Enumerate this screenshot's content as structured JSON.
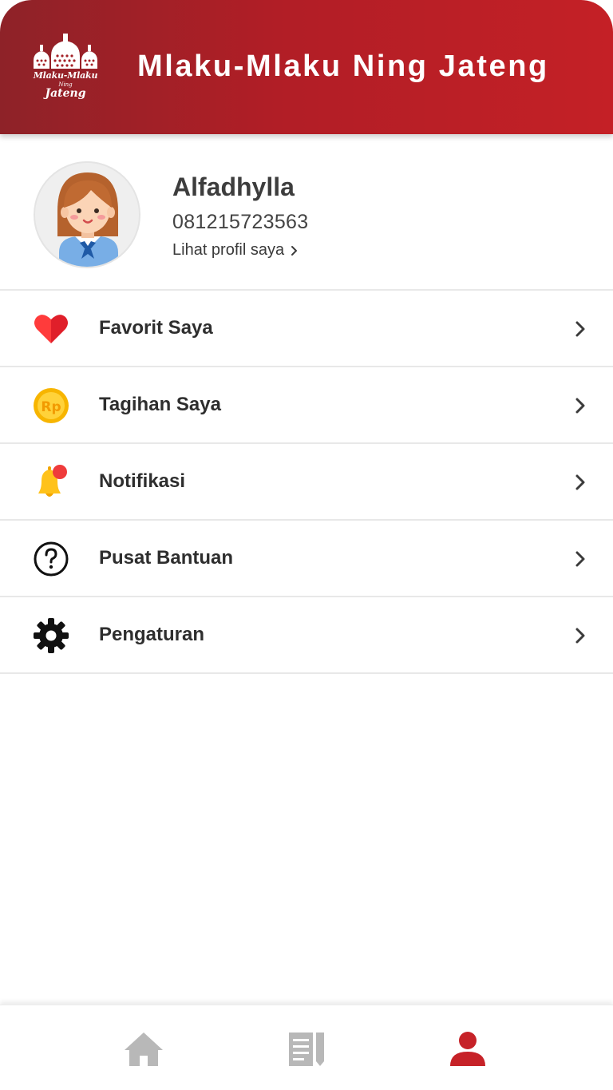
{
  "header": {
    "title": "Mlaku-Mlaku Ning Jateng",
    "logo": {
      "line1": "Mlaku-Mlaku",
      "line2": "Ning",
      "line3": "Jateng"
    }
  },
  "profile": {
    "name": "Alfadhylla",
    "phone": "081215723563",
    "link_label": "Lihat profil saya"
  },
  "menu": {
    "items": [
      {
        "label": "Favorit Saya",
        "icon": "heart-icon"
      },
      {
        "label": "Tagihan Saya",
        "icon": "rupiah-coin-icon"
      },
      {
        "label": "Notifikasi",
        "icon": "bell-icon"
      },
      {
        "label": "Pusat Bantuan",
        "icon": "help-circle-icon"
      },
      {
        "label": "Pengaturan",
        "icon": "gear-icon"
      }
    ]
  },
  "bottom_nav": {
    "items": [
      {
        "name": "home",
        "icon": "home-icon",
        "active": false
      },
      {
        "name": "articles",
        "icon": "news-icon",
        "active": false
      },
      {
        "name": "profile",
        "icon": "user-icon",
        "active": true
      }
    ]
  },
  "colors": {
    "brand_red": "#c42026",
    "header_dark": "#8e2228",
    "inactive_nav": "#b8b8b8",
    "active_nav": "#c62228"
  }
}
